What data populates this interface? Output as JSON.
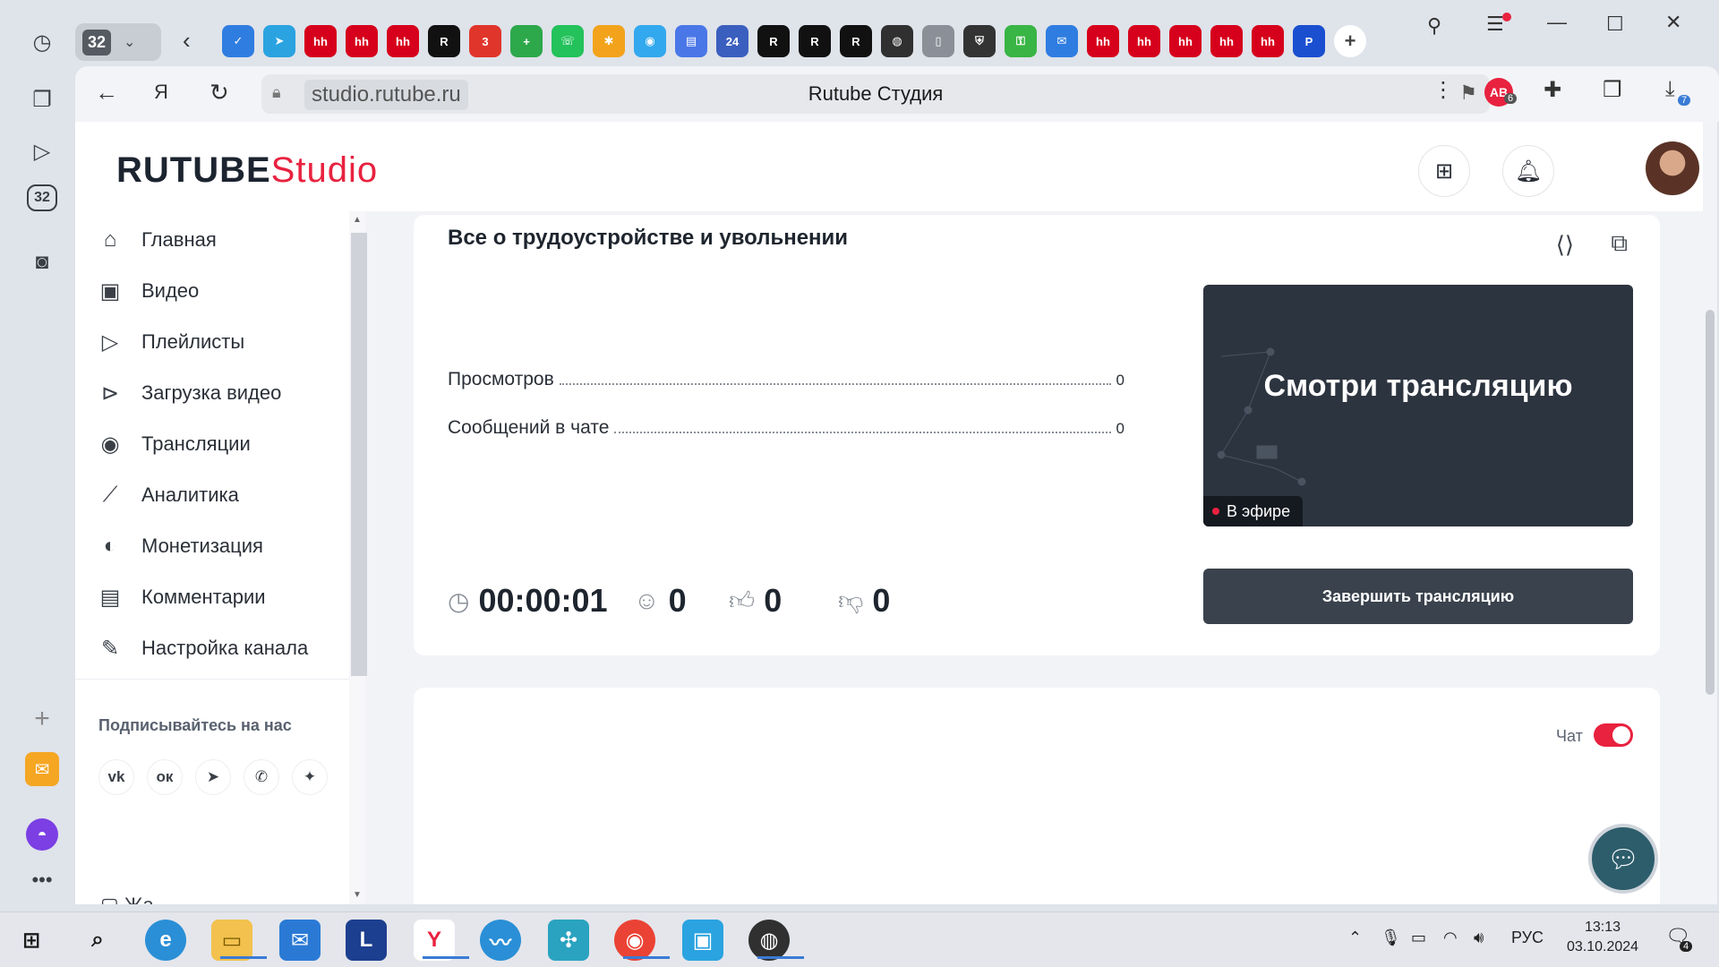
{
  "browser": {
    "tab_count": "32",
    "tab_icons": [
      {
        "icon": "check-icon",
        "color": "#2f7de1",
        "text": "✓"
      },
      {
        "icon": "telegram-icon",
        "color": "#2aa3e0",
        "text": "➤"
      },
      {
        "icon": "hh-icon",
        "color": "#d6001c",
        "text": "hh"
      },
      {
        "icon": "hh-icon",
        "color": "#d6001c",
        "text": "hh"
      },
      {
        "icon": "hh-icon",
        "color": "#d6001c",
        "text": "hh"
      },
      {
        "icon": "rutube-icon",
        "color": "#111111",
        "text": "R"
      },
      {
        "icon": "calendar-icon",
        "color": "#e0352b",
        "text": "3"
      },
      {
        "icon": "plus-app-icon",
        "color": "#2da84b",
        "text": "+"
      },
      {
        "icon": "whatsapp-icon",
        "color": "#23c25b",
        "text": "☏"
      },
      {
        "icon": "pinwheel-icon",
        "color": "#f2a31b",
        "text": "✱"
      },
      {
        "icon": "chat-app-icon",
        "color": "#32a8ee",
        "text": "◉"
      },
      {
        "icon": "doc-app-icon",
        "color": "#4a77e8",
        "text": "▤"
      },
      {
        "icon": "24-icon",
        "color": "#3b5fbf",
        "text": "24"
      },
      {
        "icon": "rutube-icon",
        "color": "#111111",
        "text": "R"
      },
      {
        "icon": "rutube-icon",
        "color": "#111111",
        "text": "R"
      },
      {
        "icon": "rutube-icon",
        "color": "#111111",
        "text": "R"
      },
      {
        "icon": "obs-icon",
        "color": "#303030",
        "text": "◍"
      },
      {
        "icon": "file-icon",
        "color": "#8a8f98",
        "text": "▯"
      },
      {
        "icon": "shield-icon",
        "color": "#333333",
        "text": "⛨"
      },
      {
        "icon": "key-icon",
        "color": "#38b544",
        "text": "⚿"
      },
      {
        "icon": "mail-icon",
        "color": "#2f7de1",
        "text": "✉"
      },
      {
        "icon": "hh-icon",
        "color": "#d6001c",
        "text": "hh"
      },
      {
        "icon": "hh-icon",
        "color": "#d6001c",
        "text": "hh"
      },
      {
        "icon": "hh-icon",
        "color": "#d6001c",
        "text": "hh"
      },
      {
        "icon": "hh-icon",
        "color": "#d6001c",
        "text": "hh"
      },
      {
        "icon": "hh-icon",
        "color": "#d6001c",
        "text": "hh"
      },
      {
        "icon": "p-icon",
        "color": "#1a4fd0",
        "text": "P"
      }
    ],
    "url_host": "studio.rutube.ru",
    "page_title": "Rutube Студия",
    "adblock_badge": "6",
    "downloads_badge": "7"
  },
  "app": {
    "logo_brand": "RUTUBE",
    "logo_product": "Studio",
    "accent_color": "#e8223f"
  },
  "sidebar": {
    "items": [
      {
        "label": "Главная",
        "icon": "home-icon"
      },
      {
        "label": "Видео",
        "icon": "video-icon"
      },
      {
        "label": "Плейлисты",
        "icon": "playlist-icon"
      },
      {
        "label": "Загрузка видео",
        "icon": "upload-video-icon"
      },
      {
        "label": "Трансляции",
        "icon": "broadcast-icon"
      },
      {
        "label": "Аналитика",
        "icon": "analytics-icon"
      },
      {
        "label": "Монетизация",
        "icon": "monetization-icon"
      },
      {
        "label": "Комментарии",
        "icon": "comments-icon"
      },
      {
        "label": "Настройка канала",
        "icon": "channel-settings-icon"
      }
    ],
    "subscribe_title": "Подписывайтесь на нас",
    "socials": [
      {
        "icon": "vk-icon",
        "text": "vk"
      },
      {
        "icon": "odnoklassniki-icon",
        "text": "ок"
      },
      {
        "icon": "telegram-icon",
        "text": "➤"
      },
      {
        "icon": "viber-icon",
        "text": "✆"
      },
      {
        "icon": "dzen-icon",
        "text": "✦"
      }
    ]
  },
  "stream": {
    "title": "Все о трудоустройстве и увольнении",
    "stats": [
      {
        "label": "Просмотров",
        "value": "0"
      },
      {
        "label": "Сообщений в чате",
        "value": "0"
      }
    ],
    "duration": "00:00:01",
    "viewers": "0",
    "likes": "0",
    "dislikes": "0",
    "preview_text": "Смотри трансляцию",
    "live_label": "В эфире",
    "end_button": "Завершить трансляцию"
  },
  "chat": {
    "label": "Чат",
    "enabled": true
  },
  "taskbar": {
    "language": "РУС",
    "time": "13:13",
    "date": "03.10.2024",
    "notifications": "4"
  }
}
